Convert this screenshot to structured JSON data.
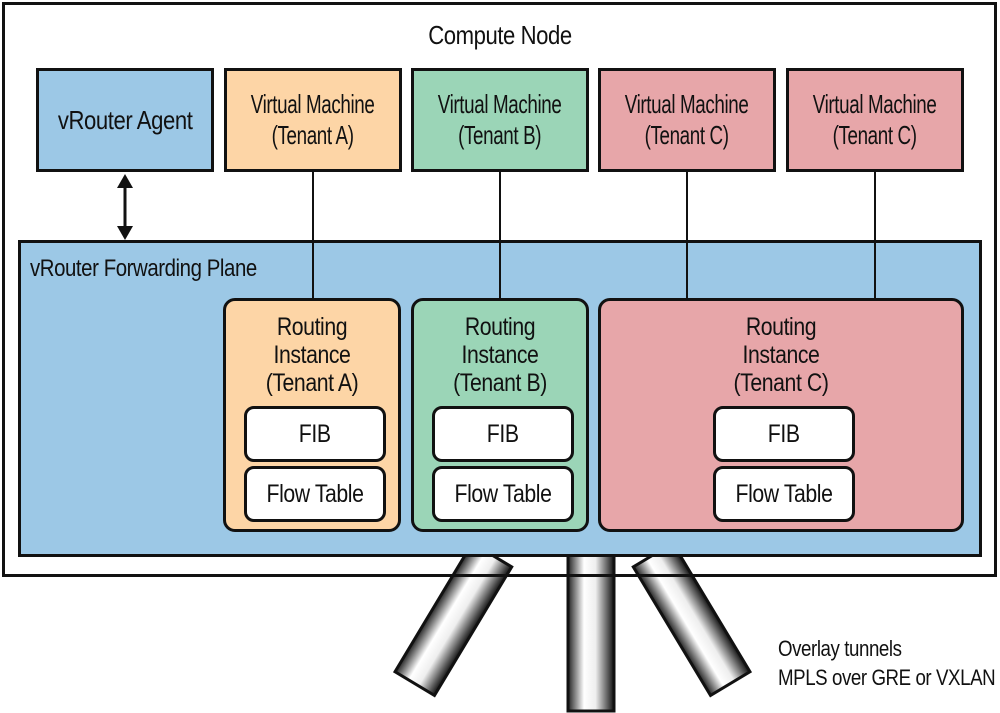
{
  "compute_node": {
    "title": "Compute Node"
  },
  "vrouter_agent": {
    "label": "vRouter Agent"
  },
  "virtual_machines": [
    {
      "line1": "Virtual Machine",
      "line2": "(Tenant A)",
      "color": "#fdd5a6"
    },
    {
      "line1": "Virtual Machine",
      "line2": "(Tenant B)",
      "color": "#9bd5b7"
    },
    {
      "line1": "Virtual Machine",
      "line2": "(Tenant C)",
      "color": "#e7a6a9"
    },
    {
      "line1": "Virtual Machine",
      "line2": "(Tenant C)",
      "color": "#e7a6a9"
    }
  ],
  "forwarding_plane": {
    "title": "vRouter Forwarding Plane"
  },
  "routing_instances": [
    {
      "line1": "Routing",
      "line2": "Instance",
      "line3": "(Tenant A)",
      "fib": "FIB",
      "flow_table": "Flow Table",
      "color": "#fdd5a6"
    },
    {
      "line1": "Routing",
      "line2": "Instance",
      "line3": "(Tenant B)",
      "fib": "FIB",
      "flow_table": "Flow Table",
      "color": "#9bd5b7"
    },
    {
      "line1": "Routing",
      "line2": "Instance",
      "line3": "(Tenant C)",
      "fib": "FIB",
      "flow_table": "Flow Table",
      "color": "#e7a6a9"
    }
  ],
  "tunnels": {
    "line1": "Overlay tunnels",
    "line2": "MPLS over GRE or VXLAN"
  },
  "colors": {
    "agent_blue": "#9cc8e6",
    "tenant_a": "#fdd5a6",
    "tenant_b": "#9bd5b7",
    "tenant_c": "#e7a6a9"
  }
}
